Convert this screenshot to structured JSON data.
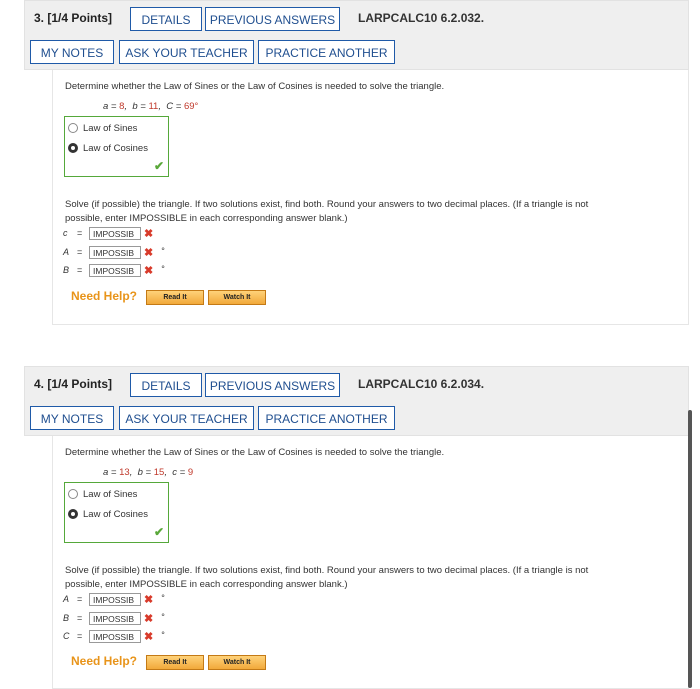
{
  "questions": [
    {
      "number": "3.",
      "points": "[1/4 Points]",
      "details": "DETAILS",
      "previous_answers": "PREVIOUS ANSWERS",
      "code": "LARPCALC10 6.2.032.",
      "my_notes": "MY NOTES",
      "ask_teacher": "ASK YOUR TEACHER",
      "practice_another": "PRACTICE ANOTHER",
      "prompt": "Determine whether the Law of Sines or the Law of Cosines is needed to solve the triangle.",
      "given": [
        {
          "var": "a",
          "value": "8"
        },
        {
          "var": "b",
          "value": "11"
        },
        {
          "var": "C",
          "value": "69°"
        }
      ],
      "options": [
        "Law of Sines",
        "Law of Cosines"
      ],
      "selected": "Law of Cosines",
      "solve_text_1": "Solve (if possible) the triangle. If two solutions exist, find both. Round your answers to two decimal places. (If a triangle is not",
      "solve_text_2": "possible, enter IMPOSSIBLE in each corresponding answer blank.)",
      "answers": [
        {
          "var": "c",
          "value": "IMPOSSIB",
          "degree": ""
        },
        {
          "var": "A",
          "value": "IMPOSSIB",
          "degree": "°"
        },
        {
          "var": "B",
          "value": "IMPOSSIB",
          "degree": "°"
        }
      ],
      "need_help": "Need Help?",
      "read_it": "Read It",
      "watch_it": "Watch It"
    },
    {
      "number": "4.",
      "points": "[1/4 Points]",
      "details": "DETAILS",
      "previous_answers": "PREVIOUS ANSWERS",
      "code": "LARPCALC10 6.2.034.",
      "my_notes": "MY NOTES",
      "ask_teacher": "ASK YOUR TEACHER",
      "practice_another": "PRACTICE ANOTHER",
      "prompt": "Determine whether the Law of Sines or the Law of Cosines is needed to solve the triangle.",
      "given": [
        {
          "var": "a",
          "value": "13"
        },
        {
          "var": "b",
          "value": "15"
        },
        {
          "var": "c",
          "value": "9"
        }
      ],
      "options": [
        "Law of Sines",
        "Law of Cosines"
      ],
      "selected": "Law of Cosines",
      "solve_text_1": "Solve (if possible) the triangle. If two solutions exist, find both. Round your answers to two decimal places. (If a triangle is not",
      "solve_text_2": "possible, enter IMPOSSIBLE in each corresponding answer blank.)",
      "answers": [
        {
          "var": "A",
          "value": "IMPOSSIB",
          "degree": "°"
        },
        {
          "var": "B",
          "value": "IMPOSSIB",
          "degree": "°"
        },
        {
          "var": "C",
          "value": "IMPOSSIB",
          "degree": "°"
        }
      ],
      "need_help": "Need Help?",
      "read_it": "Read It",
      "watch_it": "Watch It"
    }
  ],
  "colors": {
    "accent": "#1f5aa8",
    "correct": "#55a83a",
    "incorrect": "#d83a2a",
    "help": "#e8941a"
  }
}
